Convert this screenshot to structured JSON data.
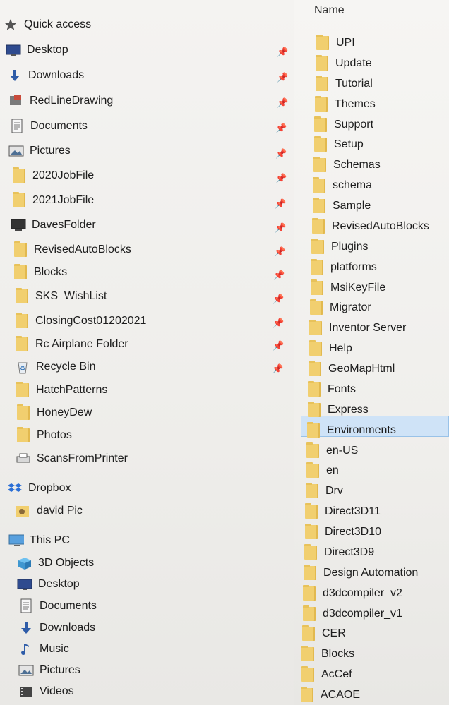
{
  "nav": {
    "quick_access": "Quick access",
    "quick_items": [
      {
        "label": "Desktop",
        "icon": "desktop-icon",
        "pinned": true
      },
      {
        "label": "Downloads",
        "icon": "download-icon",
        "pinned": true
      },
      {
        "label": "RedLineDrawing",
        "icon": "app-icon",
        "pinned": true
      },
      {
        "label": "Documents",
        "icon": "documents-icon",
        "pinned": true
      },
      {
        "label": "Pictures",
        "icon": "pictures-icon",
        "pinned": true
      },
      {
        "label": "2020JobFile",
        "icon": "folder-icon",
        "pinned": true
      },
      {
        "label": "2021JobFile",
        "icon": "folder-icon",
        "pinned": true
      },
      {
        "label": "DavesFolder",
        "icon": "computer-icon",
        "pinned": true
      },
      {
        "label": "RevisedAutoBlocks",
        "icon": "folder-icon",
        "pinned": true
      },
      {
        "label": "Blocks",
        "icon": "folder-icon",
        "pinned": true
      },
      {
        "label": "SKS_WishList",
        "icon": "folder-icon",
        "pinned": true
      },
      {
        "label": "ClosingCost01202021",
        "icon": "folder-icon",
        "pinned": true
      },
      {
        "label": "Rc Airplane Folder",
        "icon": "folder-icon",
        "pinned": true
      },
      {
        "label": "Recycle Bin",
        "icon": "recycle-bin-icon",
        "pinned": true
      },
      {
        "label": "HatchPatterns",
        "icon": "folder-icon",
        "pinned": false
      },
      {
        "label": "HoneyDew",
        "icon": "folder-icon",
        "pinned": false
      },
      {
        "label": "Photos",
        "icon": "folder-icon",
        "pinned": false
      },
      {
        "label": "ScansFromPrinter",
        "icon": "printer-icon",
        "pinned": false
      }
    ],
    "dropbox": "Dropbox",
    "dropbox_item": "david Pic",
    "this_pc": "This PC",
    "pc_items": [
      {
        "label": "3D Objects",
        "icon": "3d-objects-icon"
      },
      {
        "label": "Desktop",
        "icon": "desktop-icon"
      },
      {
        "label": "Documents",
        "icon": "documents-icon"
      },
      {
        "label": "Downloads",
        "icon": "download-icon"
      },
      {
        "label": "Music",
        "icon": "music-icon"
      },
      {
        "label": "Pictures",
        "icon": "pictures-icon"
      },
      {
        "label": "Videos",
        "icon": "videos-icon"
      }
    ]
  },
  "content": {
    "header_name": "Name",
    "selected": "Express",
    "folders": [
      "UPI",
      "Update",
      "Tutorial",
      "Themes",
      "Support",
      "Setup",
      "Schemas",
      "schema",
      "Sample",
      "RevisedAutoBlocks",
      "Plugins",
      "platforms",
      "MsiKeyFile",
      "Migrator",
      "Inventor Server",
      "Help",
      "GeoMapHtml",
      "Fonts",
      "Express",
      "Environments",
      "en-US",
      "en",
      "Drv",
      "Direct3D11",
      "Direct3D10",
      "Direct3D9",
      "Design Automation",
      "d3dcompiler_v2",
      "d3dcompiler_v1",
      "CER",
      "Blocks",
      "AcCef",
      "ACAOE"
    ]
  }
}
